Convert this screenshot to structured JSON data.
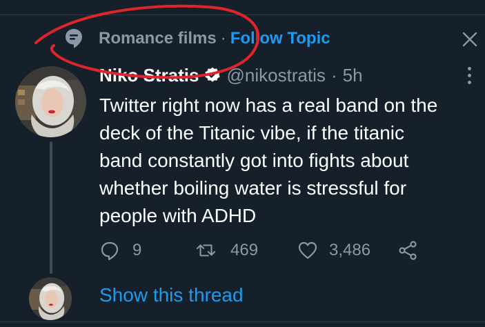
{
  "topic": {
    "icon": "topic-bubble-icon",
    "label": "Romance films",
    "separator": "·",
    "follow_label": "Follow Topic"
  },
  "close_icon": "close-icon",
  "tweet": {
    "author_name": "Niko Stratis",
    "verified_icon": "verified-badge-icon",
    "handle": "@nikostratis",
    "separator": "·",
    "time": "5h",
    "more_icon": "more-vertical-icon",
    "text": "Twitter right now has a real band on the\ndeck of the Titanic vibe, if the titanic\nband constantly got into fights about\nwhether boiling water is stressful for\npeople with ADHD",
    "actions": {
      "reply": {
        "icon": "reply-icon",
        "count": "9"
      },
      "retweet": {
        "icon": "retweet-icon",
        "count": "469"
      },
      "like": {
        "icon": "heart-icon",
        "count": "3,486"
      },
      "share": {
        "icon": "share-icon"
      }
    }
  },
  "thread": {
    "show_label": "Show this thread"
  },
  "colors": {
    "background": "#15202b",
    "accent": "#1d9bf0",
    "muted": "#8b98a5",
    "annotation": "#e0242e"
  }
}
